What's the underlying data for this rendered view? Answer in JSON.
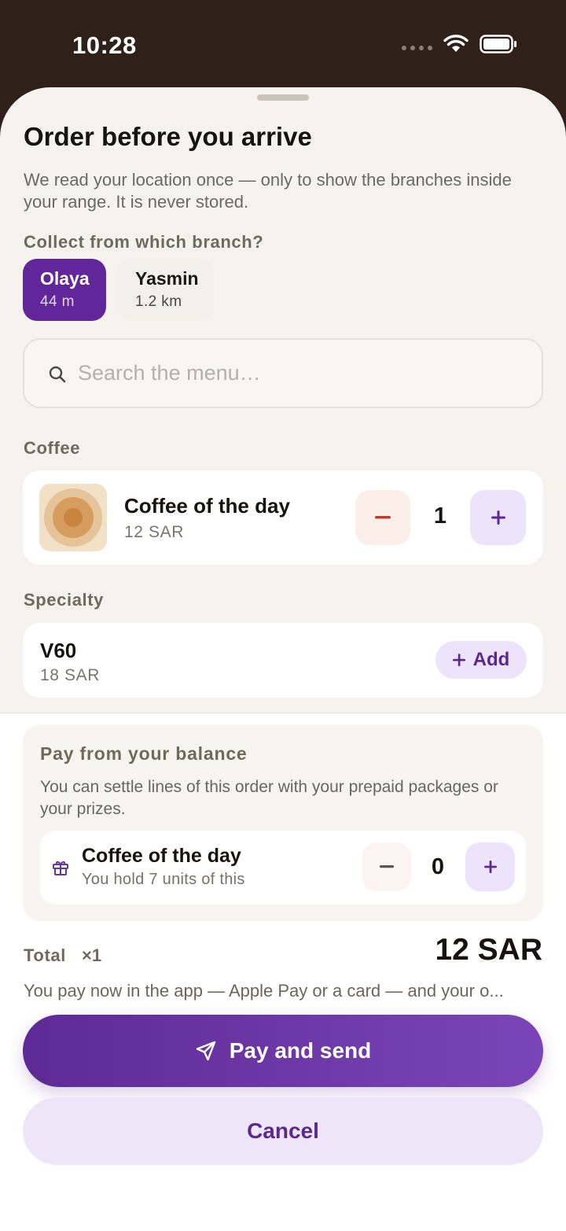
{
  "status": {
    "time": "10:28"
  },
  "sheet": {
    "title": "Order before you arrive",
    "subtitle": "We read your location once — only to show the branches inside your range. It is never stored.",
    "branch_label": "Collect from which branch?",
    "branches": [
      {
        "name": "Olaya",
        "distance": "44 m",
        "selected": true
      },
      {
        "name": "Yasmin",
        "distance": "1.2 km",
        "selected": false
      }
    ],
    "search": {
      "placeholder": "Search the menu…",
      "value": ""
    }
  },
  "menu": {
    "coffee_label": "Coffee",
    "coffee_item": {
      "name": "Coffee of the day",
      "price": "12 SAR",
      "qty": "1"
    },
    "specialty_label": "Specialty",
    "specialty_item": {
      "name": "V60",
      "price": "18 SAR",
      "add_label": "Add"
    }
  },
  "balance": {
    "title": "Pay from your balance",
    "description": "You can settle lines of this order with your prepaid packages or your prizes.",
    "item": {
      "name": "Coffee of the day",
      "sub": "You hold 7 units of this",
      "qty": "0"
    }
  },
  "totals": {
    "label": "Total",
    "count": "×1",
    "amount": "12 SAR",
    "note": "You pay now in the app — Apple Pay or a card — and your o..."
  },
  "actions": {
    "pay_label": "Pay and send",
    "cancel_label": "Cancel"
  },
  "colors": {
    "accent": "#61269a",
    "sheet_bg": "#f6f3ee",
    "header_bg": "#2f2119"
  }
}
